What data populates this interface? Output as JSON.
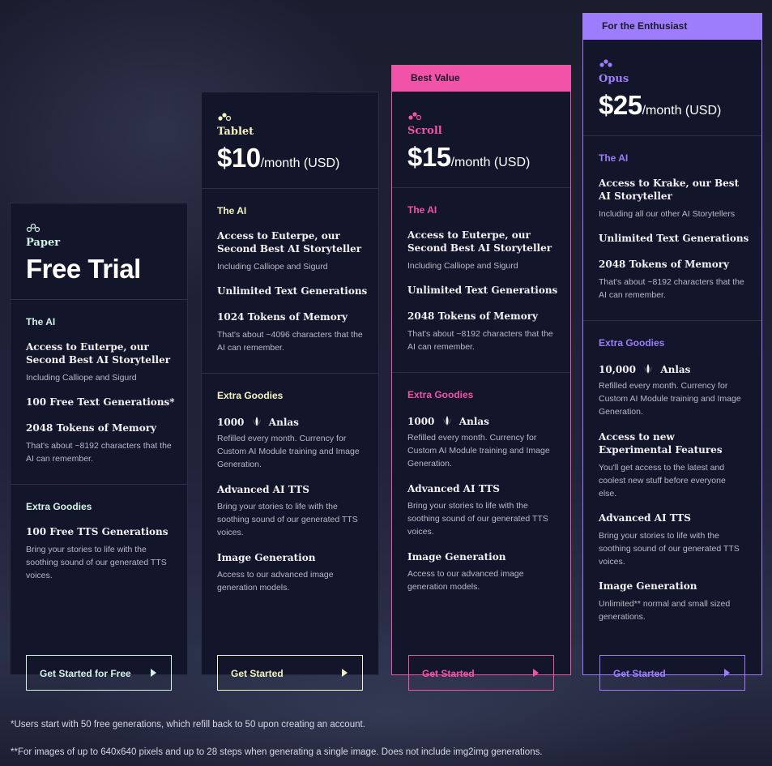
{
  "colors": {
    "paper": "#d2f3e6",
    "tablet": "#f5f3c2",
    "scroll": "#f153a8",
    "opus": "#9d7dfc"
  },
  "plans": {
    "paper": {
      "icon": "paper-tier-icon",
      "name": "Paper",
      "price": "Free Trial",
      "ai_title": "The AI",
      "f1": "Access to Euterpe, our Second Best AI Storyteller",
      "f1_desc": "Including Calliope and Sigurd",
      "f2": "100 Free Text Generations*",
      "f3": "2048 Tokens of Memory",
      "f3_desc": "That's about ~8192 characters that the AI can remember.",
      "extras_title": "Extra Goodies",
      "e1": "100 Free TTS Generations",
      "e1_desc": "Bring your stories to life with the soothing sound of our generated TTS voices.",
      "button": "Get Started for Free"
    },
    "tablet": {
      "icon": "tablet-tier-icon",
      "name": "Tablet",
      "price": "$10",
      "per": "/month (USD)",
      "ai_title": "The AI",
      "f1": "Access to Euterpe, our Second Best AI Storyteller",
      "f1_desc": "Including Calliope and Sigurd",
      "f2": "Unlimited Text Generations",
      "f3": "1024 Tokens of Memory",
      "f3_desc": "That's about ~4096 characters that the AI can remember.",
      "extras_title": "Extra Goodies",
      "anlas_count": "1000",
      "anlas_label": "Anlas",
      "anlas_desc": "Refilled every month. Currency for Custom AI Module training and Image Generation.",
      "e2": "Advanced AI TTS",
      "e2_desc": "Bring your stories to life with the soothing sound of our generated TTS voices.",
      "e3": "Image Generation",
      "e3_desc": "Access to our advanced image generation models.",
      "button": "Get Started"
    },
    "scroll": {
      "ribbon": "Best Value",
      "icon": "scroll-tier-icon",
      "name": "Scroll",
      "price": "$15",
      "per": "/month (USD)",
      "ai_title": "The AI",
      "f1": "Access to Euterpe, our Second Best AI Storyteller",
      "f1_desc": "Including Calliope and Sigurd",
      "f2": "Unlimited Text Generations",
      "f3": "2048 Tokens of Memory",
      "f3_desc": "That's about ~8192 characters that the AI can remember.",
      "extras_title": "Extra Goodies",
      "anlas_count": "1000",
      "anlas_label": "Anlas",
      "anlas_desc": "Refilled every month. Currency for Custom AI Module training and Image Generation.",
      "e2": "Advanced AI TTS",
      "e2_desc": "Bring your stories to life with the soothing sound of our generated TTS voices.",
      "e3": "Image Generation",
      "e3_desc": "Access to our advanced image generation models.",
      "button": "Get Started"
    },
    "opus": {
      "ribbon": "For the Enthusiast",
      "icon": "opus-tier-icon",
      "name": "Opus",
      "price": "$25",
      "per": "/month (USD)",
      "ai_title": "The AI",
      "f1": "Access to Krake, our Best AI Storyteller",
      "f1_desc": "Including all our other AI Storytellers",
      "f2": "Unlimited Text Generations",
      "f3": "2048 Tokens of Memory",
      "f3_desc": "That's about ~8192 characters that the AI can remember.",
      "extras_title": "Extra Goodies",
      "anlas_count": "10,000",
      "anlas_label": "Anlas",
      "anlas_desc": "Refilled every month. Currency for Custom AI Module training and Image Generation.",
      "e_exp": "Access to new Experimental Features",
      "e_exp_desc": "You'll get access to the latest and coolest new stuff before everyone else.",
      "e2": "Advanced AI TTS",
      "e2_desc": "Bring your stories to life with the soothing sound of our generated TTS voices.",
      "e3": "Image Generation",
      "e3_desc": "Unlimited** normal and small sized generations.",
      "button": "Get Started"
    }
  },
  "footnotes": {
    "one": "*Users start with 50 free generations, which refill back to 50 upon creating an account.",
    "two": "**For images of up to 640x640 pixels and up to 28 steps when generating a single image. Does not include img2img generations."
  }
}
